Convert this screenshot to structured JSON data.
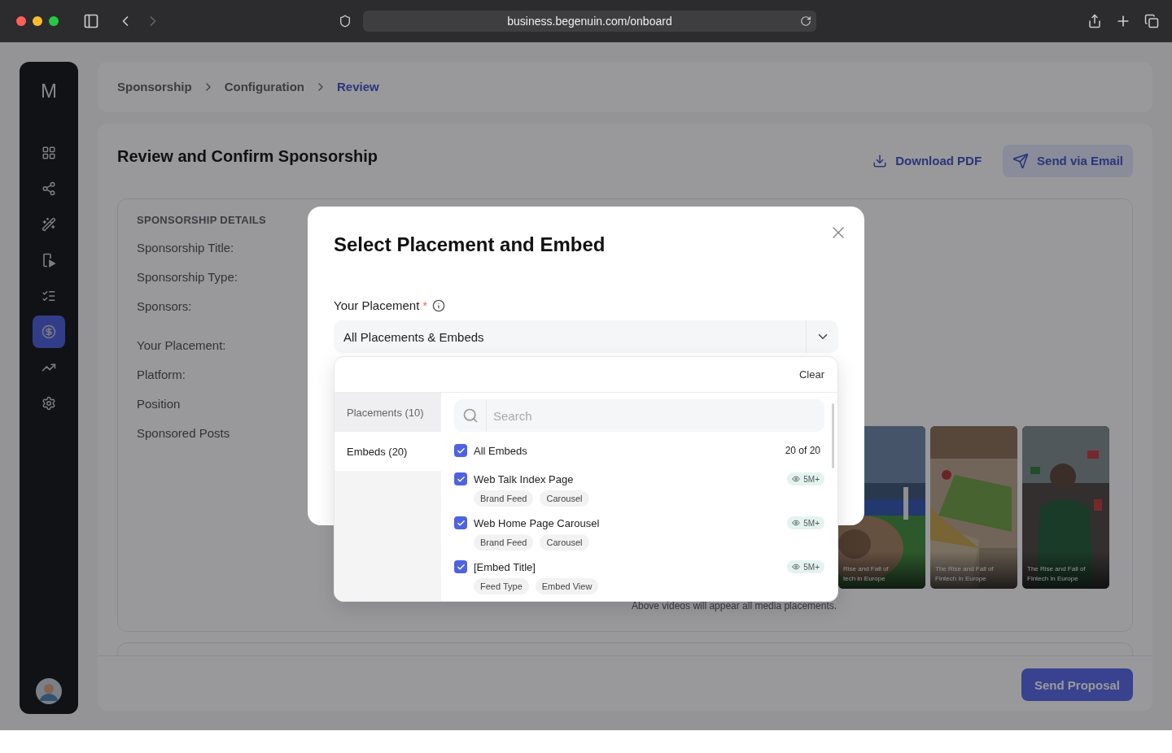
{
  "browser": {
    "url": "business.begenuin.com/onboard"
  },
  "sidebar": {
    "logo": "M",
    "items": [
      {
        "selected": false
      },
      {
        "selected": false
      },
      {
        "selected": false
      },
      {
        "selected": false
      },
      {
        "selected": false
      },
      {
        "selected": true
      },
      {
        "selected": false
      },
      {
        "selected": false
      }
    ]
  },
  "breadcrumb": [
    {
      "label": "Sponsorship",
      "selected": false
    },
    {
      "label": "Configuration",
      "selected": false
    },
    {
      "label": "Review",
      "selected": true
    }
  ],
  "page": {
    "title": "Review and Confirm Sponsorship",
    "actions": [
      {
        "label": "Download PDF",
        "kind": "link"
      },
      {
        "label": "Send via Email",
        "kind": "button"
      }
    ]
  },
  "details": {
    "heading": "SPONSORSHIP DETAILS",
    "groups": [
      [
        "Sponsorship Title:",
        "Sponsorship Type:",
        "Sponsors:"
      ],
      [
        "Your Placement:",
        "Platform:",
        "Position",
        "Sponsored Posts"
      ]
    ]
  },
  "gallery": {
    "cards": [
      {
        "caption_lines": [
          "Rise and Fall of",
          "tech in Europe"
        ]
      },
      {
        "caption_lines": [
          "The Rise and Fall of",
          "Fintech in Europe"
        ]
      },
      {
        "caption_lines": [
          "The Rise and Fall of",
          "Fintech in Europe"
        ]
      }
    ],
    "note": "Above videos will appear all media placements."
  },
  "footer": {
    "button": "Send Proposal"
  },
  "modal": {
    "title": "Select Placement and Embed",
    "field": {
      "label": "Your Placement",
      "required_mark": "*",
      "value": "All Placements & Embeds"
    },
    "dropdown": {
      "clear": "Clear",
      "tabs": [
        {
          "label": "Placements (10)",
          "selected": false
        },
        {
          "label": "Embeds (20)",
          "selected": true
        }
      ],
      "search": {
        "placeholder": "Search"
      },
      "all": {
        "label": "All Embeds",
        "checked": true,
        "count": "20 of 20"
      },
      "items": [
        {
          "title": "Web Talk Index Page",
          "checked": true,
          "views": "5M+",
          "tags": [
            "Brand Feed",
            "Carousel"
          ]
        },
        {
          "title": "Web Home Page Carousel",
          "checked": true,
          "views": "5M+",
          "tags": [
            "Brand Feed",
            "Carousel"
          ]
        },
        {
          "title": "[Embed Title]",
          "checked": true,
          "views": "5M+",
          "tags": [
            "Feed Type",
            "Embed View"
          ]
        }
      ]
    }
  }
}
